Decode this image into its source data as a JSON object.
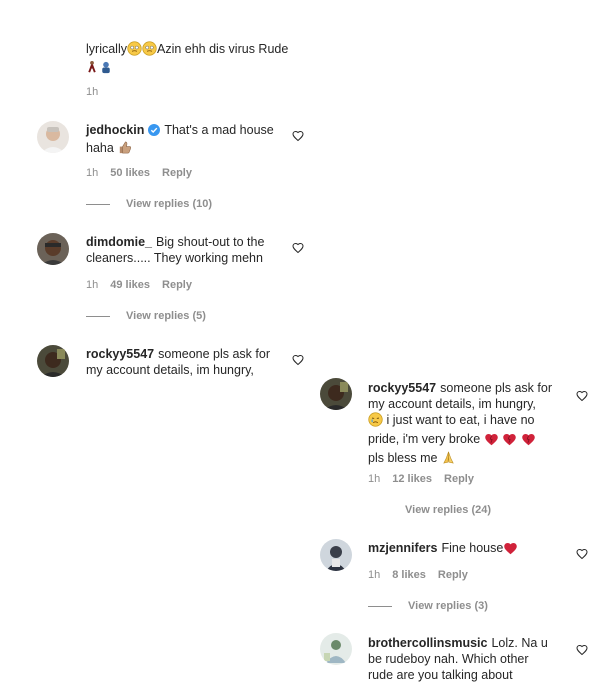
{
  "top_comment": {
    "text_line1": "lyrically",
    "text_line1b": "Azin ehh dis virus Rude",
    "time": "1h"
  },
  "comments": [
    {
      "username": "jedhockin",
      "text_a": "That's a mad house",
      "text_b": "haha",
      "time": "1h",
      "likes": "50 likes",
      "reply": "Reply",
      "view_replies": "View replies (10)"
    },
    {
      "username": "dimdomie_",
      "text_a": "Big shout-out to the",
      "text_b": "cleaners..... They working mehn",
      "time": "1h",
      "likes": "49 likes",
      "reply": "Reply",
      "view_replies": "View replies (5)"
    },
    {
      "username": "rockyy5547",
      "text_a": "someone pls ask for",
      "text_b": "my account details, im hungry,"
    },
    {
      "username": "rockyy5547",
      "text_a": "someone pls ask for",
      "text_b": "my account details, im hungry,",
      "text_c": "i just want to eat, i have no",
      "text_d": "pride, i'm very broke",
      "text_e": "pls bless me",
      "time": "1h",
      "likes": "12 likes",
      "reply": "Reply",
      "view_replies": "View replies (24)"
    },
    {
      "username": "mzjennifers",
      "text_a": "Fine house",
      "time": "1h",
      "likes": "8 likes",
      "reply": "Reply",
      "view_replies": "View replies (3)"
    },
    {
      "username": "brothercollinsmusic",
      "text_a": "Lolz. Na u",
      "text_b": "be rudeboy nah. Which other",
      "text_c": "rude are you talking about"
    }
  ],
  "colors": {
    "text": "#262626",
    "muted": "#8e8e8e",
    "verified": "#3897f0",
    "heart_red": "#d0223a"
  },
  "icons": [
    "heart-outline-icon",
    "verified-badge-icon",
    "thumbs-up-emoji",
    "pleading-face-emoji",
    "crying-face-emoji",
    "red-heart-emoji",
    "praying-hands-emoji",
    "dancing-emoji"
  ]
}
